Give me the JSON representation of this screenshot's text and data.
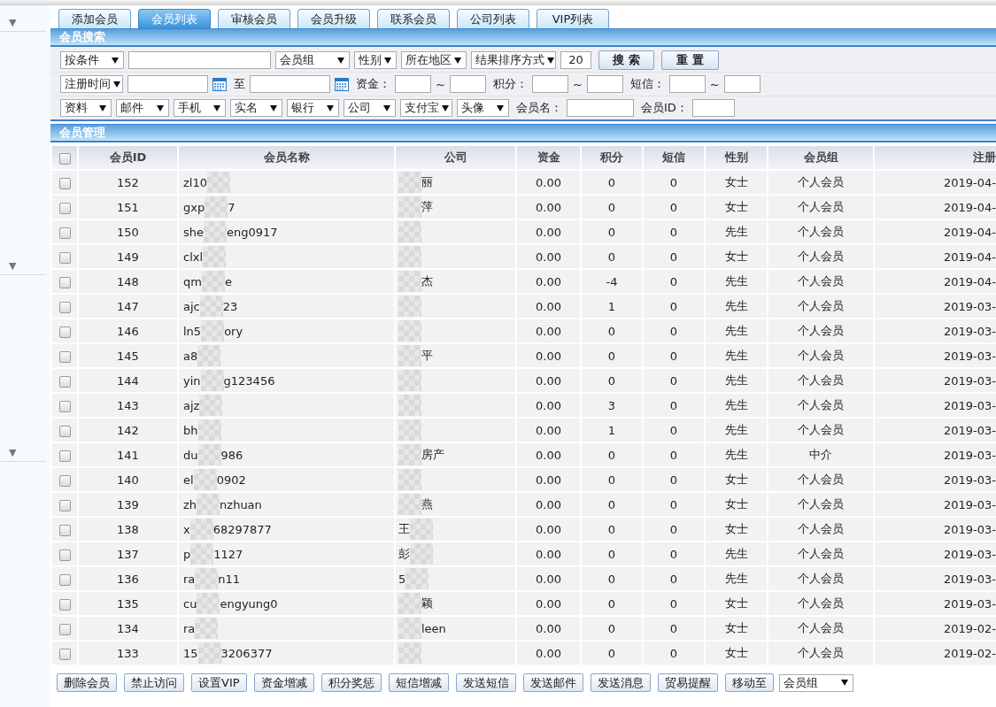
{
  "sidebar": {
    "toggles": [
      "▼",
      "▼",
      "▼"
    ]
  },
  "tabs": [
    {
      "label": "添加会员",
      "selected": false
    },
    {
      "label": "会员列表",
      "selected": true
    },
    {
      "label": "审核会员",
      "selected": false
    },
    {
      "label": "会员升级",
      "selected": false
    },
    {
      "label": "联系会员",
      "selected": false
    },
    {
      "label": "公司列表",
      "selected": false
    },
    {
      "label": "VIP列表",
      "selected": false
    }
  ],
  "search": {
    "title": "会员搜索",
    "query_row": [
      {
        "kind": "select",
        "value": "按条件"
      },
      {
        "kind": "input"
      },
      {
        "kind": "select",
        "value": "会员组"
      },
      {
        "kind": "select",
        "value": "性别"
      },
      {
        "kind": "select",
        "value": "所在地区"
      },
      {
        "kind": "select",
        "value": "结果排序方式"
      },
      {
        "kind": "input",
        "value": "20"
      },
      {
        "kind": "button",
        "label": "搜 索"
      },
      {
        "kind": "button",
        "label": "重 置"
      }
    ],
    "range_row": [
      {
        "kind": "select",
        "value": "注册时间"
      },
      {
        "kind": "input"
      },
      {
        "kind": "calendar"
      },
      {
        "kind": "label",
        "text": "至"
      },
      {
        "kind": "input"
      },
      {
        "kind": "calendar"
      },
      {
        "kind": "label",
        "text": "资金："
      },
      {
        "kind": "input"
      },
      {
        "kind": "sep",
        "text": "~"
      },
      {
        "kind": "input"
      },
      {
        "kind": "label",
        "text": "积分："
      },
      {
        "kind": "input"
      },
      {
        "kind": "sep",
        "text": "~"
      },
      {
        "kind": "input"
      },
      {
        "kind": "label",
        "text": "短信："
      },
      {
        "kind": "input"
      },
      {
        "kind": "sep",
        "text": "~"
      },
      {
        "kind": "input"
      }
    ],
    "filter_row": [
      {
        "kind": "select",
        "value": "资料"
      },
      {
        "kind": "select",
        "value": "邮件"
      },
      {
        "kind": "select",
        "value": "手机"
      },
      {
        "kind": "select",
        "value": "实名"
      },
      {
        "kind": "select",
        "value": "银行"
      },
      {
        "kind": "select",
        "value": "公司"
      },
      {
        "kind": "select",
        "value": "支付宝"
      },
      {
        "kind": "select",
        "value": "头像"
      },
      {
        "kind": "label",
        "text": "会员名："
      },
      {
        "kind": "input"
      },
      {
        "kind": "label",
        "text": "会员ID："
      },
      {
        "kind": "input"
      }
    ]
  },
  "members": {
    "title": "会员管理",
    "header_checkbox": {
      "checked": false
    },
    "columns": [
      "会员ID",
      "会员名称",
      "公司",
      "资金",
      "积分",
      "短信",
      "性别",
      "会员组",
      "注册"
    ],
    "rows": [
      {
        "checked": false,
        "id": "152",
        "name": {
          "head": "zl10"
        },
        "company": {
          "tail": "丽"
        },
        "funds": "0.00",
        "points": "0",
        "sms": "0",
        "gender": "女士",
        "group": "个人会员",
        "registered": "2019-04-"
      },
      {
        "checked": false,
        "id": "151",
        "name": {
          "head": "gxp",
          "tail": "7"
        },
        "company": {
          "tail": "萍"
        },
        "funds": "0.00",
        "points": "0",
        "sms": "0",
        "gender": "女士",
        "group": "个人会员",
        "registered": "2019-04-"
      },
      {
        "checked": false,
        "id": "150",
        "name": {
          "head": "she",
          "tail": "eng0917"
        },
        "funds": "0.00",
        "points": "0",
        "sms": "0",
        "gender": "先生",
        "group": "个人会员",
        "registered": "2019-04-"
      },
      {
        "checked": false,
        "id": "149",
        "name": {
          "head": "clxl"
        },
        "funds": "0.00",
        "points": "0",
        "sms": "0",
        "gender": "女士",
        "group": "个人会员",
        "registered": "2019-04-"
      },
      {
        "checked": false,
        "id": "148",
        "name": {
          "head": "qm",
          "tail": "e"
        },
        "company": {
          "tail": "杰"
        },
        "funds": "0.00",
        "points": "-4",
        "sms": "0",
        "gender": "先生",
        "group": "个人会员",
        "registered": "2019-04-"
      },
      {
        "checked": false,
        "id": "147",
        "name": {
          "head": "ajc",
          "tail": "23"
        },
        "funds": "0.00",
        "points": "1",
        "sms": "0",
        "gender": "先生",
        "group": "个人会员",
        "registered": "2019-03-"
      },
      {
        "checked": false,
        "id": "146",
        "name": {
          "head": "ln5",
          "tail": "ory"
        },
        "funds": "0.00",
        "points": "0",
        "sms": "0",
        "gender": "先生",
        "group": "个人会员",
        "registered": "2019-03-"
      },
      {
        "checked": false,
        "id": "145",
        "name": {
          "head": "a8"
        },
        "company": {
          "tail": "平"
        },
        "funds": "0.00",
        "points": "0",
        "sms": "0",
        "gender": "先生",
        "group": "个人会员",
        "registered": "2019-03-"
      },
      {
        "checked": false,
        "id": "144",
        "name": {
          "head": "yin",
          "tail": "g123456"
        },
        "funds": "0.00",
        "points": "0",
        "sms": "0",
        "gender": "先生",
        "group": "个人会员",
        "registered": "2019-03-"
      },
      {
        "checked": false,
        "id": "143",
        "name": {
          "head": "ajz"
        },
        "funds": "0.00",
        "points": "3",
        "sms": "0",
        "gender": "先生",
        "group": "个人会员",
        "registered": "2019-03-"
      },
      {
        "checked": false,
        "id": "142",
        "name": {
          "head": "bh"
        },
        "funds": "0.00",
        "points": "1",
        "sms": "0",
        "gender": "先生",
        "group": "个人会员",
        "registered": "2019-03-"
      },
      {
        "checked": false,
        "id": "141",
        "name": {
          "head": "du",
          "tail": "986"
        },
        "company": {
          "tail": "房产"
        },
        "funds": "0.00",
        "points": "0",
        "sms": "0",
        "gender": "先生",
        "group": "中介",
        "registered": "2019-03-"
      },
      {
        "checked": false,
        "id": "140",
        "name": {
          "head": "el",
          "tail": "0902"
        },
        "funds": "0.00",
        "points": "0",
        "sms": "0",
        "gender": "女士",
        "group": "个人会员",
        "registered": "2019-03-"
      },
      {
        "checked": false,
        "id": "139",
        "name": {
          "head": "zh",
          "tail": "nzhuan"
        },
        "company": {
          "tail": "燕"
        },
        "funds": "0.00",
        "points": "0",
        "sms": "0",
        "gender": "女士",
        "group": "个人会员",
        "registered": "2019-03-"
      },
      {
        "checked": false,
        "id": "138",
        "name": {
          "head": "x",
          "tail": "68297877"
        },
        "company": {
          "head": "王"
        },
        "funds": "0.00",
        "points": "0",
        "sms": "0",
        "gender": "女士",
        "group": "个人会员",
        "registered": "2019-03-"
      },
      {
        "checked": false,
        "id": "137",
        "name": {
          "head": "p",
          "tail": "1127"
        },
        "company": {
          "head": "彭"
        },
        "funds": "0.00",
        "points": "0",
        "sms": "0",
        "gender": "先生",
        "group": "个人会员",
        "registered": "2019-03-"
      },
      {
        "checked": false,
        "id": "136",
        "name": {
          "head": "ra",
          "tail": "n11"
        },
        "company": {
          "head": "5"
        },
        "funds": "0.00",
        "points": "0",
        "sms": "0",
        "gender": "先生",
        "group": "个人会员",
        "registered": "2019-03-"
      },
      {
        "checked": false,
        "id": "135",
        "name": {
          "head": "cu",
          "tail": "engyung0"
        },
        "company": {
          "tail": "颖"
        },
        "funds": "0.00",
        "points": "0",
        "sms": "0",
        "gender": "女士",
        "group": "个人会员",
        "registered": "2019-03-"
      },
      {
        "checked": false,
        "id": "134",
        "name": {
          "head": "ra"
        },
        "company": {
          "tail": "leen"
        },
        "funds": "0.00",
        "points": "0",
        "sms": "0",
        "gender": "女士",
        "group": "个人会员",
        "registered": "2019-02-"
      },
      {
        "checked": false,
        "id": "133",
        "name": {
          "head": "15",
          "tail": "3206377"
        },
        "funds": "0.00",
        "points": "0",
        "sms": "0",
        "gender": "女士",
        "group": "个人会员",
        "registered": "2019-02-"
      }
    ]
  },
  "actions": {
    "buttons": [
      "删除会员",
      "禁止访问",
      "设置VIP",
      "资金增减",
      "积分奖惩",
      "短信增减",
      "发送短信",
      "发送邮件",
      "发送消息",
      "贸易提醒",
      "移动至"
    ],
    "move_select": "会员组"
  }
}
